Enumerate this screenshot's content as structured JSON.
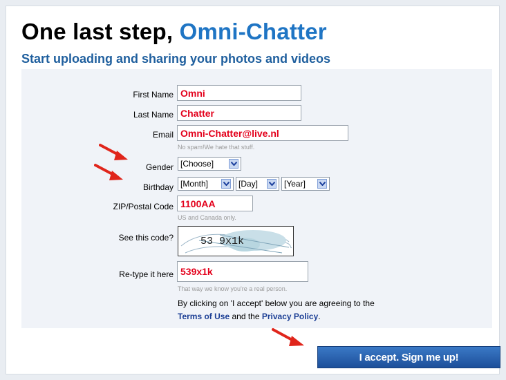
{
  "header": {
    "title_prefix": "One last step, ",
    "title_name": "Omni-Chatter",
    "subtitle": "Start uploading and sharing your photos and videos"
  },
  "form": {
    "first_name": {
      "label": "First Name",
      "value": "Omni"
    },
    "last_name": {
      "label": "Last Name",
      "value": "Chatter"
    },
    "email": {
      "label": "Email",
      "value": "Omni-Chatter@live.nl",
      "hint": "No spam!We hate that stuff."
    },
    "gender": {
      "label": "Gender",
      "selected": "[Choose]"
    },
    "birthday": {
      "label": "Birthday",
      "month": "[Month]",
      "day": "[Day]",
      "year": "[Year]"
    },
    "zip": {
      "label": "ZIP/Postal Code",
      "value": "1100AA",
      "hint": "US and Canada only."
    },
    "captcha": {
      "label": "See this code?",
      "code": "53 9x1k"
    },
    "retype": {
      "label": "Re-type it here",
      "value": "539x1k",
      "hint": "That way we know you're a real person."
    }
  },
  "agreement": {
    "line1": "By clicking on 'I accept' below you are agreeing to the",
    "terms_link": "Terms of Use",
    "middle": " and the ",
    "privacy_link": "Privacy Policy",
    "end": "."
  },
  "submit": {
    "label": "I accept. Sign me up!"
  },
  "colors": {
    "title_accent": "#1f75c4",
    "subtitle": "#1f5f9e",
    "input_text": "#e3001b",
    "link": "#1c3f95",
    "button": "#2a62b0",
    "arrow": "#e0251b"
  }
}
